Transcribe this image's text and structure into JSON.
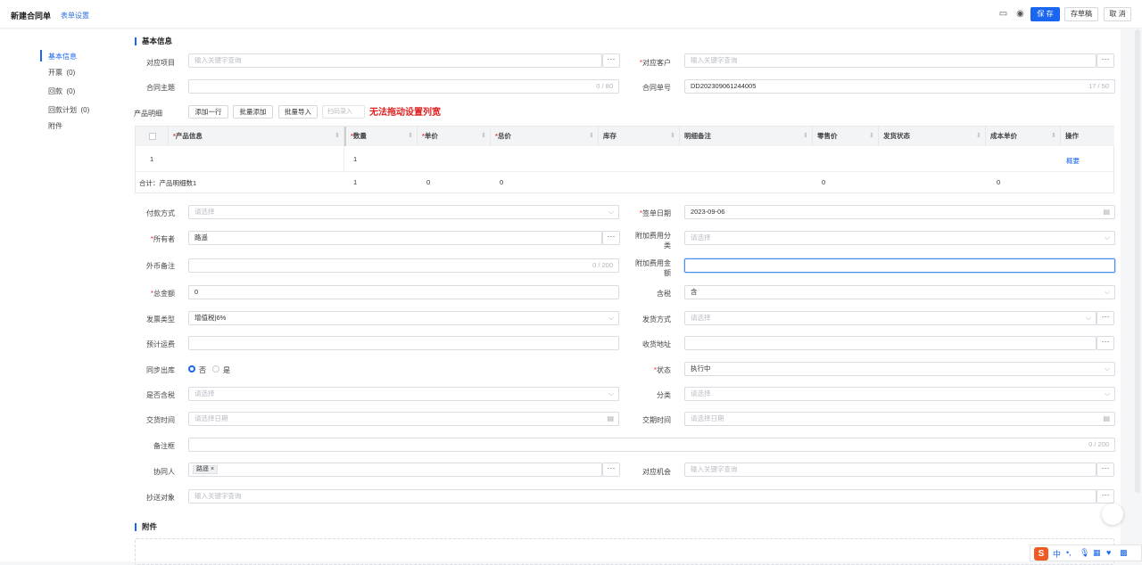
{
  "header": {
    "title": "新建合同单",
    "form_settings": "表单设置",
    "save": "保 存",
    "draft": "存草稿",
    "cancel": "取 消"
  },
  "sidebar": {
    "items": [
      {
        "label": "基本信息"
      },
      {
        "label": "开票",
        "count": "(0)"
      },
      {
        "label": "回款",
        "count": "(0)"
      },
      {
        "label": "回款计划",
        "count": "(0)"
      },
      {
        "label": "附件"
      }
    ]
  },
  "section_basic": "基本信息",
  "section_attach": "附件",
  "fields": {
    "project": {
      "label": "对应项目",
      "placeholder": "输入关键字查询"
    },
    "customer": {
      "label": "对应客户",
      "placeholder": "输入关键字查询"
    },
    "subject": {
      "label": "合同主题",
      "count": "0 / 80"
    },
    "number": {
      "label": "合同单号",
      "value": "DD202309061244005",
      "count": "17 / 50"
    },
    "payment": {
      "label": "付款方式",
      "placeholder": "请选择"
    },
    "sign_date": {
      "label": "签单日期",
      "value": "2023-09-06"
    },
    "owner": {
      "label": "所有者",
      "value": "路遥"
    },
    "extra_fee_cat": {
      "label": "附加费用分",
      "label2": "类",
      "placeholder": "请选择"
    },
    "fx_note": {
      "label": "外币备注",
      "count": "0 / 200"
    },
    "extra_fee_amt": {
      "label": "附加费用金",
      "label2": "额"
    },
    "total": {
      "label": "总金额",
      "value": "0"
    },
    "tax": {
      "label": "含税",
      "value": "含"
    },
    "invoice_type": {
      "label": "发票类型",
      "value": "增值税|6%"
    },
    "ship_method": {
      "label": "发货方式",
      "placeholder": "请选择"
    },
    "freight": {
      "label": "预计运费"
    },
    "ship_addr": {
      "label": "收货地址"
    },
    "sync_out": {
      "label": "同步出库",
      "opt_no": "否",
      "opt_yes": "是"
    },
    "status": {
      "label": "状态",
      "value": "执行中"
    },
    "is_tax": {
      "label": "是否含税",
      "placeholder": "请选择"
    },
    "category": {
      "label": "分类",
      "placeholder": "请选择"
    },
    "deliver_time": {
      "label": "交货时间",
      "placeholder": "请选择日期"
    },
    "due_time": {
      "label": "交期时间",
      "placeholder": "请选择日期"
    },
    "remark": {
      "label": "备注框",
      "count": "0 / 200"
    },
    "collab": {
      "label": "协同人",
      "tag": "路遥"
    },
    "opportunity": {
      "label": "对应机会",
      "placeholder": "输入关键字查询"
    },
    "cc": {
      "label": "抄送对象",
      "placeholder": "输入关键字查询"
    }
  },
  "products": {
    "label": "产品明细",
    "add_row": "添加一行",
    "batch_add": "批量添加",
    "batch_import": "批量导入",
    "scan": "扫码录入",
    "annotation": "无法拖动设置列宽",
    "columns": [
      "产品信息",
      "数量",
      "单价",
      "总价",
      "库存",
      "明细备注",
      "零售价",
      "发货状态",
      "成本单价",
      "操作"
    ],
    "row": {
      "index": "1",
      "qty": "1",
      "action": "概要"
    },
    "summary": {
      "label": "合计：产品明细数1",
      "qty": "1",
      "price": "0",
      "total": "0",
      "retail": "0",
      "cost": "0"
    }
  },
  "ime": {
    "lang": "中"
  }
}
